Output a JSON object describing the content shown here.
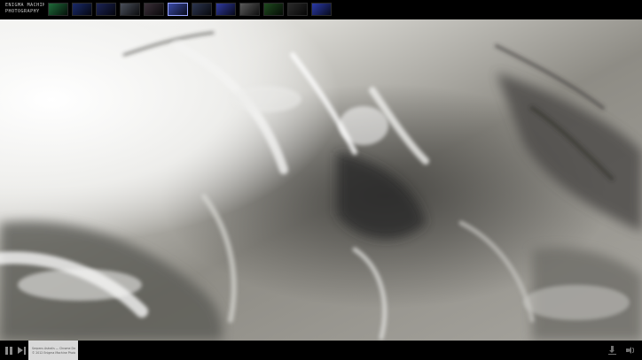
{
  "header": {
    "logo_line1": "ENIGMA MACHINE",
    "logo_line2": "PHOTOGRAPHY"
  },
  "gallery": {
    "thumbnails": [
      {
        "color": "#1f6b3a"
      },
      {
        "color": "#1a2a6a"
      },
      {
        "color": "#1c2456"
      },
      {
        "color": "#4a4f5a"
      },
      {
        "color": "#3a2f38"
      },
      {
        "color": "#3a4aa8",
        "active": true
      },
      {
        "color": "#2c3550"
      },
      {
        "color": "#2f3aa0"
      },
      {
        "color": "#5a5a5a"
      },
      {
        "color": "#1f4a1f"
      },
      {
        "color": "#2a2a2a"
      },
      {
        "color": "#2a3aa8"
      }
    ]
  },
  "player": {
    "caption_line1": "Serpens Astralis — Chrome Dream",
    "caption_line2": "© 2012 Enigma Machine Photography"
  },
  "colors": {
    "bar_bg": "#000000",
    "caption_bg": "#d8d8d8",
    "icon": "#8a8a8a",
    "accent": "#9aa6ff"
  }
}
